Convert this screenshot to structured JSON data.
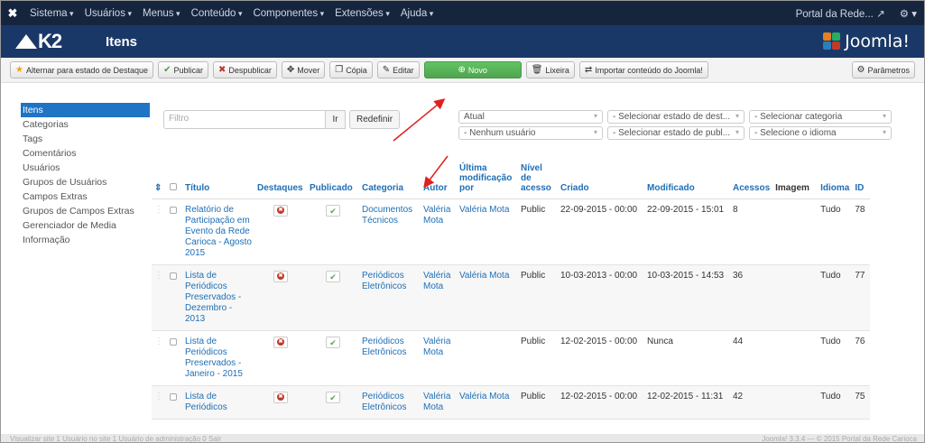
{
  "topnav": {
    "menus": [
      "Sistema",
      "Usuários",
      "Menus",
      "Conteúdo",
      "Componentes",
      "Extensões",
      "Ajuda"
    ],
    "site_link": "Portal da Rede...",
    "settings_icon": "gear-icon"
  },
  "header": {
    "logo_text": "K2",
    "title": "Itens",
    "joomla_text": "Joomla!"
  },
  "toolbar": {
    "featured": "Alternar para estado de Destaque",
    "publish": "Publicar",
    "unpublish": "Despublicar",
    "move": "Mover",
    "copy": "Cópia",
    "edit": "Editar",
    "new": "Novo",
    "trash": "Lixeira",
    "import": "Importar conteúdo do Joomla!",
    "params": "Parâmetros"
  },
  "sidebar": {
    "items": [
      "Itens",
      "Categorias",
      "Tags",
      "Comentários",
      "Usuários",
      "Grupos de Usuários",
      "Campos Extras",
      "Grupos de Campos Extras",
      "Gerenciador de Media",
      "Informação"
    ]
  },
  "filter": {
    "placeholder": "Filtro",
    "go": "Ir",
    "reset": "Redefinir"
  },
  "selects": {
    "state": "Atual",
    "user": "- Nenhum usuário",
    "featured_state": "- Selecionar estado de dest...",
    "publish_state": "- Selecionar estado de publ...",
    "category": "- Selecionar categoria",
    "language": "- Selecione o idioma"
  },
  "table": {
    "headers": {
      "title": "Título",
      "featured": "Destaques",
      "published": "Publicado",
      "category": "Categoria",
      "author": "Autor",
      "modified_by": "Última modificação por",
      "access": "Nível de acesso",
      "created": "Criado",
      "modified": "Modificado",
      "hits": "Acessos",
      "image": "Imagem",
      "language": "Idioma",
      "id": "ID"
    },
    "rows": [
      {
        "title": "Relatório de Participação em Evento da Rede Carioca - Agosto 2015",
        "category": "Documentos Técnicos",
        "author": "Valéria Mota",
        "modified_by": "Valéria Mota",
        "access": "Public",
        "created": "22-09-2015 - 00:00",
        "modified": "22-09-2015 - 15:01",
        "hits": "8",
        "language": "Tudo",
        "id": "78"
      },
      {
        "title": "Lista de Periódicos Preservados - Dezembro - 2013",
        "category": "Periódicos Eletrônicos",
        "author": "Valéria Mota",
        "modified_by": "Valéria Mota",
        "access": "Public",
        "created": "10-03-2013 - 00:00",
        "modified": "10-03-2015 - 14:53",
        "hits": "36",
        "language": "Tudo",
        "id": "77"
      },
      {
        "title": "Lista de Periódicos Preservados - Janeiro - 2015",
        "category": "Periódicos Eletrônicos",
        "author": "Valéria Mota",
        "modified_by": "",
        "access": "Public",
        "created": "12-02-2015 - 00:00",
        "modified": "Nunca",
        "hits": "44",
        "language": "Tudo",
        "id": "76"
      },
      {
        "title": "Lista de Periódicos",
        "category": "Periódicos Eletrônicos",
        "author": "Valéria Mota",
        "modified_by": "Valéria Mota",
        "access": "Public",
        "created": "12-02-2015 - 00:00",
        "modified": "12-02-2015 - 11:31",
        "hits": "42",
        "language": "Tudo",
        "id": "75"
      }
    ]
  },
  "footer": {
    "left": "Visualizar site  1 Usuário no site  1 Usuário de administração  0  Sair",
    "right": "Joomla! 3.3.4  —  © 2015 Portal da Rede Carioca"
  },
  "colors": {
    "topnav_bg": "#16253e",
    "header_bg": "#1a3867",
    "accent": "#1f6fb5",
    "new_button": "#51a351",
    "arrow": "#e02020"
  }
}
